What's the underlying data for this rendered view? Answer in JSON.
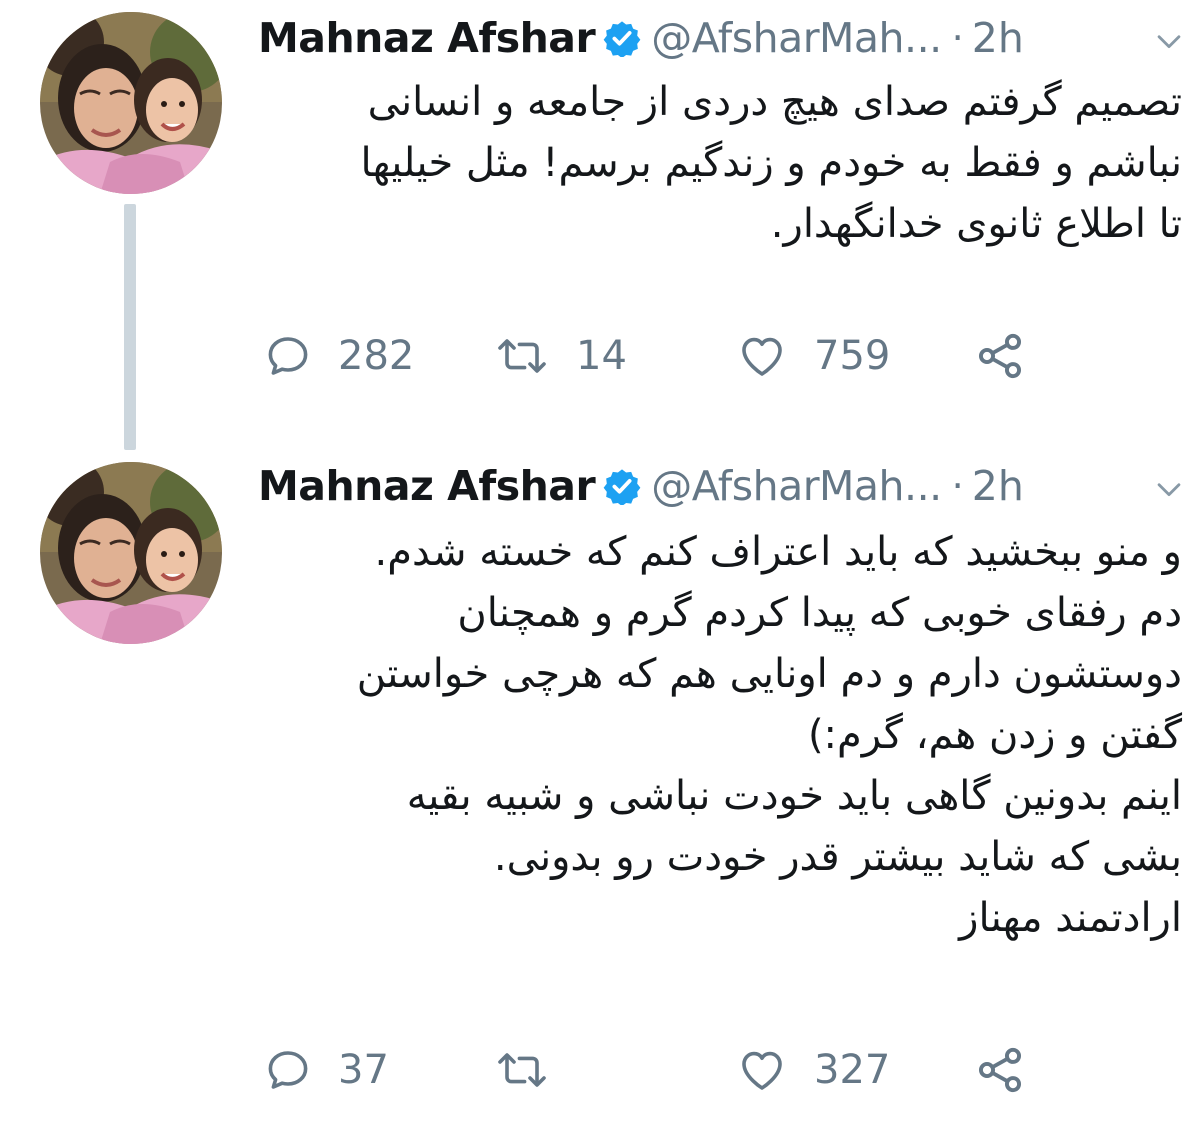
{
  "colors": {
    "text": "#14171a",
    "secondary": "#657786",
    "verified": "#1da1f2",
    "thread_line": "#ccd6dd"
  },
  "tweets": [
    {
      "author": {
        "name": "Mahnaz Afshar",
        "handle": "@AfsharMah...",
        "verified": true,
        "avatar": "avatar-photo"
      },
      "separator": "·",
      "time": "2h",
      "menu_icon": "chevron-down-icon",
      "text_lines": [
        "تصمیم گرفتم صدای هیچ دردی از جامعه و انسانی",
        "نباشم و فقط به خودم و زندگیم برسم! مثل خیلیها",
        "تا اطلاع ثانوی خدانگهدار."
      ],
      "actions": {
        "reply": {
          "icon": "reply-icon",
          "count": "282"
        },
        "retweet": {
          "icon": "retweet-icon",
          "count": "14"
        },
        "like": {
          "icon": "heart-icon",
          "count": "759"
        },
        "share": {
          "icon": "share-icon"
        }
      }
    },
    {
      "author": {
        "name": "Mahnaz Afshar",
        "handle": "@AfsharMah...",
        "verified": true,
        "avatar": "avatar-photo"
      },
      "separator": "·",
      "time": "2h",
      "menu_icon": "chevron-down-icon",
      "text_lines": [
        "و منو ببخشید که باید اعتراف کنم که خسته شدم.",
        "دم رفقای خوبی که پیدا کردم گرم و همچنان",
        "دوستشون دارم و دم اونایی هم که هرچی خواستن",
        "گفتن و زدن هم، گرم:)",
        "اینم بدونین گاهی باید خودت نباشی و شبیه بقیه",
        "بشی که شاید بیشتر قدر خودت رو بدونی.",
        "ارادتمند مهناز"
      ],
      "actions": {
        "reply": {
          "icon": "reply-icon",
          "count": "37"
        },
        "retweet": {
          "icon": "retweet-icon",
          "count": ""
        },
        "like": {
          "icon": "heart-icon",
          "count": "327"
        },
        "share": {
          "icon": "share-icon"
        }
      }
    }
  ]
}
